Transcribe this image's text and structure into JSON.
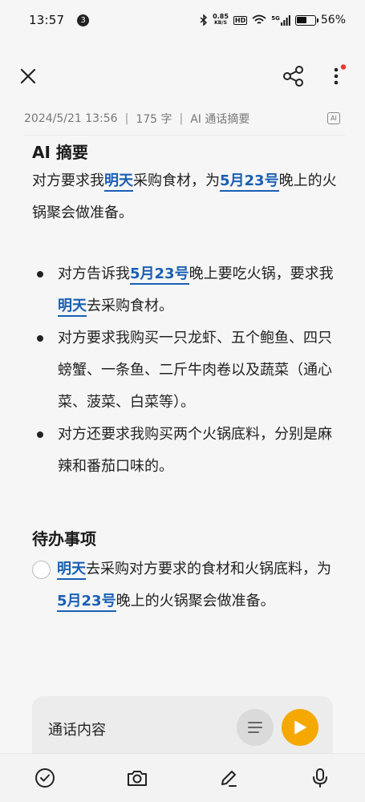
{
  "status_bar": {
    "time": "13:57",
    "notification_count": "3",
    "net_speed_value": "0.85",
    "net_speed_unit": "KB/S",
    "hd_label": "HD",
    "signal_label": "5G",
    "battery_percent": "56%",
    "battery_level": 0.56
  },
  "toolbar": {
    "close_icon": "close-icon",
    "share_icon": "share-icon",
    "more_icon": "more-vertical-icon",
    "has_badge": true,
    "badge_color": "#e53935"
  },
  "meta": {
    "datetime": "2024/5/21 13:56",
    "separator": "|",
    "word_count": "175 字",
    "source": "AI 通话摘要",
    "ai_badge": "AI"
  },
  "summary": {
    "title": "AI 摘要",
    "intro": {
      "t1": "对方要求我",
      "h1": "明天",
      "t2": "采购食材，为",
      "h2": "5月23号",
      "t3": "晚上的火锅聚会做准备。"
    },
    "bullets": [
      {
        "t1": "对方告诉我",
        "h1": "5月23号",
        "t2": "晚上要吃火锅，要求我",
        "h2": "明天",
        "t3": "去采购食材。"
      },
      {
        "t1": "对方要求我购买一只龙虾、五个鲍鱼、四只螃蟹、一条鱼、二斤牛肉卷以及蔬菜（通心菜、菠菜、白菜等）。"
      },
      {
        "t1": "对方还要求我购买两个火锅底料，分别是麻辣和番茄口味的。"
      }
    ]
  },
  "todo": {
    "title": "待办事项",
    "items": [
      {
        "h1": "明天",
        "t1": "去采购对方要求的食材和火锅底料，为",
        "h2": "5月23号",
        "t2": "晚上的火锅聚会做准备。",
        "checked": false
      }
    ]
  },
  "call_card": {
    "label": "通话内容",
    "list_icon": "list-icon",
    "play_icon": "play-icon",
    "accent": "#f5a800"
  },
  "bottom_bar": {
    "icons": [
      "check-circle-icon",
      "camera-icon",
      "pen-icon",
      "microphone-icon"
    ]
  },
  "colors": {
    "highlight": "#1a5fb4",
    "background": "#f6f6f6"
  }
}
